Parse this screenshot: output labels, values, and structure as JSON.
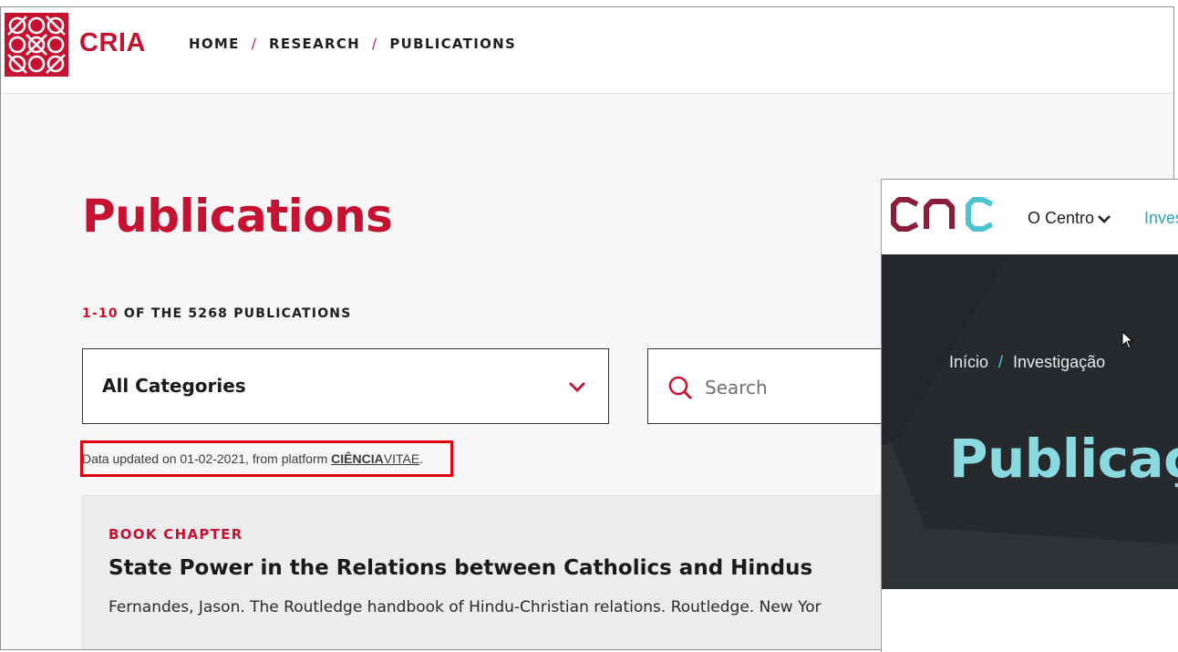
{
  "cria": {
    "logo_text": "CRIA",
    "breadcrumb": [
      "HOME",
      "RESEARCH",
      "PUBLICATIONS"
    ],
    "breadcrumb_separator": "/",
    "page_title": "Publications",
    "count": {
      "range": "1-10",
      "rest": " OF THE 5268 PUBLICATIONS"
    },
    "category_select": {
      "selected": "All Categories",
      "icon": "chevron-down-icon"
    },
    "search": {
      "placeholder": "Search",
      "value": "",
      "icon": "search-icon"
    },
    "data_note": {
      "prefix": "Data updated on 01-02-2021, from platform ",
      "link_bold": "CIÊNCIA",
      "link_rest": "VITAE",
      "suffix": "."
    },
    "publication": {
      "type": "BOOK CHAPTER",
      "title": "State Power in the Relations between Catholics and Hindus",
      "citation": "Fernandes, Jason. The Routledge handbook of Hindu-Christian relations. Routledge. New Yor"
    },
    "colors": {
      "accent": "#c41230",
      "highlight_box": "#e3000f"
    }
  },
  "cnc": {
    "logo_text": "cnc",
    "menu": {
      "centro": "O Centro",
      "invest": "Inves"
    },
    "breadcrumb": [
      "Início",
      "Investigação"
    ],
    "breadcrumb_separator": "/",
    "page_title": "Publicaçõ",
    "colors": {
      "hero_bg": "#262a2d",
      "title": "#8ad8e0",
      "logo_dark": "#8b1d3b",
      "logo_teal": "#4cc3cf"
    }
  }
}
